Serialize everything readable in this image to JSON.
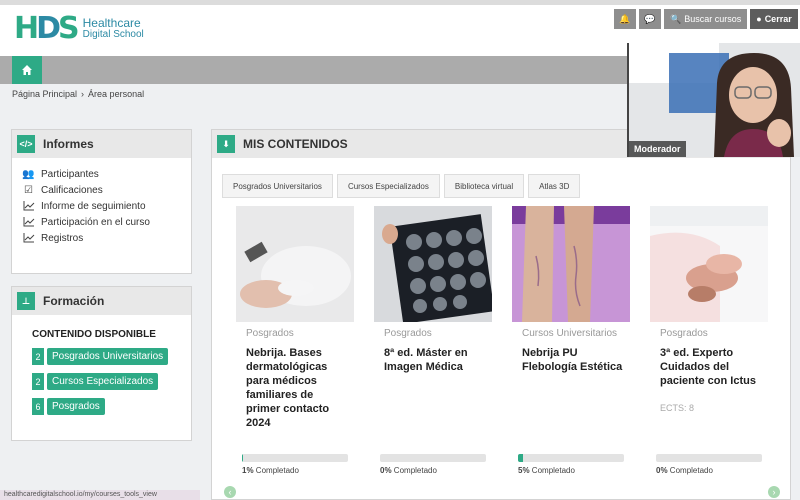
{
  "header": {
    "logo_mark": "HDS",
    "logo_line1": "Healthcare",
    "logo_line2": "Digital School",
    "search_label": "Buscar cursos",
    "logout_label": "Cerrar"
  },
  "breadcrumb": {
    "home": "Página Principal",
    "separator": "›",
    "current": "Área personal"
  },
  "informes": {
    "title": "Informes",
    "items": [
      {
        "label": "Participantes",
        "icon": "users-icon"
      },
      {
        "label": "Calificaciones",
        "icon": "calendar-check-icon"
      },
      {
        "label": "Informe de seguimiento",
        "icon": "chart-line-icon"
      },
      {
        "label": "Participación en el curso",
        "icon": "chart-line-icon"
      },
      {
        "label": "Registros",
        "icon": "chart-line-icon"
      }
    ]
  },
  "formacion": {
    "title": "Formación",
    "subtitle": "CONTENIDO DISPONIBLE",
    "items": [
      {
        "count": "2",
        "label": "Posgrados Universitarios"
      },
      {
        "count": "2",
        "label": "Cursos Especializados"
      },
      {
        "count": "6",
        "label": "Posgrados"
      }
    ]
  },
  "contents": {
    "title": "MIS CONTENIDOS",
    "tabs": [
      "Posgrados Universitarios",
      "Cursos Especializados",
      "Biblioteca virtual",
      "Atlas 3D"
    ],
    "cards": [
      {
        "category": "Posgrados",
        "title": "Nebrija. Bases dermatológicas para médicos familiares de primer contacto 2024",
        "ects": "",
        "progress": 1,
        "pct_label": "1%",
        "done_label": "Completado"
      },
      {
        "category": "Posgrados",
        "title": "8ª ed. Máster en Imagen Médica",
        "ects": "",
        "progress": 0,
        "pct_label": "0%",
        "done_label": "Completado"
      },
      {
        "category": "Cursos Universitarios",
        "title": "Nebrija PU Flebología Estética",
        "ects": "",
        "progress": 5,
        "pct_label": "5%",
        "done_label": "Completado"
      },
      {
        "category": "Posgrados",
        "title": "3ª ed. Experto Cuidados del paciente con Ictus",
        "ects": "ECTS: 8",
        "progress": 0,
        "pct_label": "0%",
        "done_label": "Completado"
      }
    ]
  },
  "video": {
    "label": "Moderador"
  },
  "status_url": "healthcaredigitalschool.io/my/courses_tools_view",
  "colors": {
    "accent": "#2eaa86",
    "brand_blue": "#2c8aa4"
  }
}
